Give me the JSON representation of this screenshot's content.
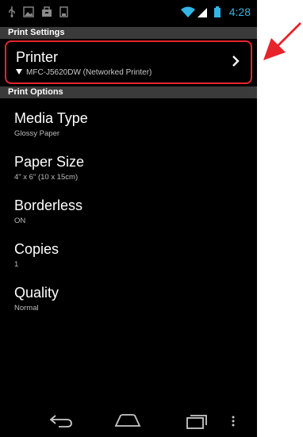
{
  "status_bar": {
    "time": "4:28",
    "icons": [
      "usb-icon",
      "image-icon",
      "briefcase-icon",
      "sd-card-icon",
      "wifi-icon",
      "signal-icon",
      "battery-icon"
    ]
  },
  "print_settings": {
    "header": "Print Settings",
    "printer": {
      "title": "Printer",
      "value": "MFC-J5620DW (Networked Printer)"
    }
  },
  "print_options": {
    "header": "Print Options",
    "items": [
      {
        "title": "Media Type",
        "value": "Glossy Paper"
      },
      {
        "title": "Paper Size",
        "value": "4\" x 6\" (10 x 15cm)"
      },
      {
        "title": "Borderless",
        "value": "ON"
      },
      {
        "title": "Copies",
        "value": "1"
      },
      {
        "title": "Quality",
        "value": "Normal"
      }
    ]
  },
  "colors": {
    "highlight_border": "#e8242b",
    "section_header_bg": "#3a3a3a",
    "accent": "#33b5e5"
  }
}
